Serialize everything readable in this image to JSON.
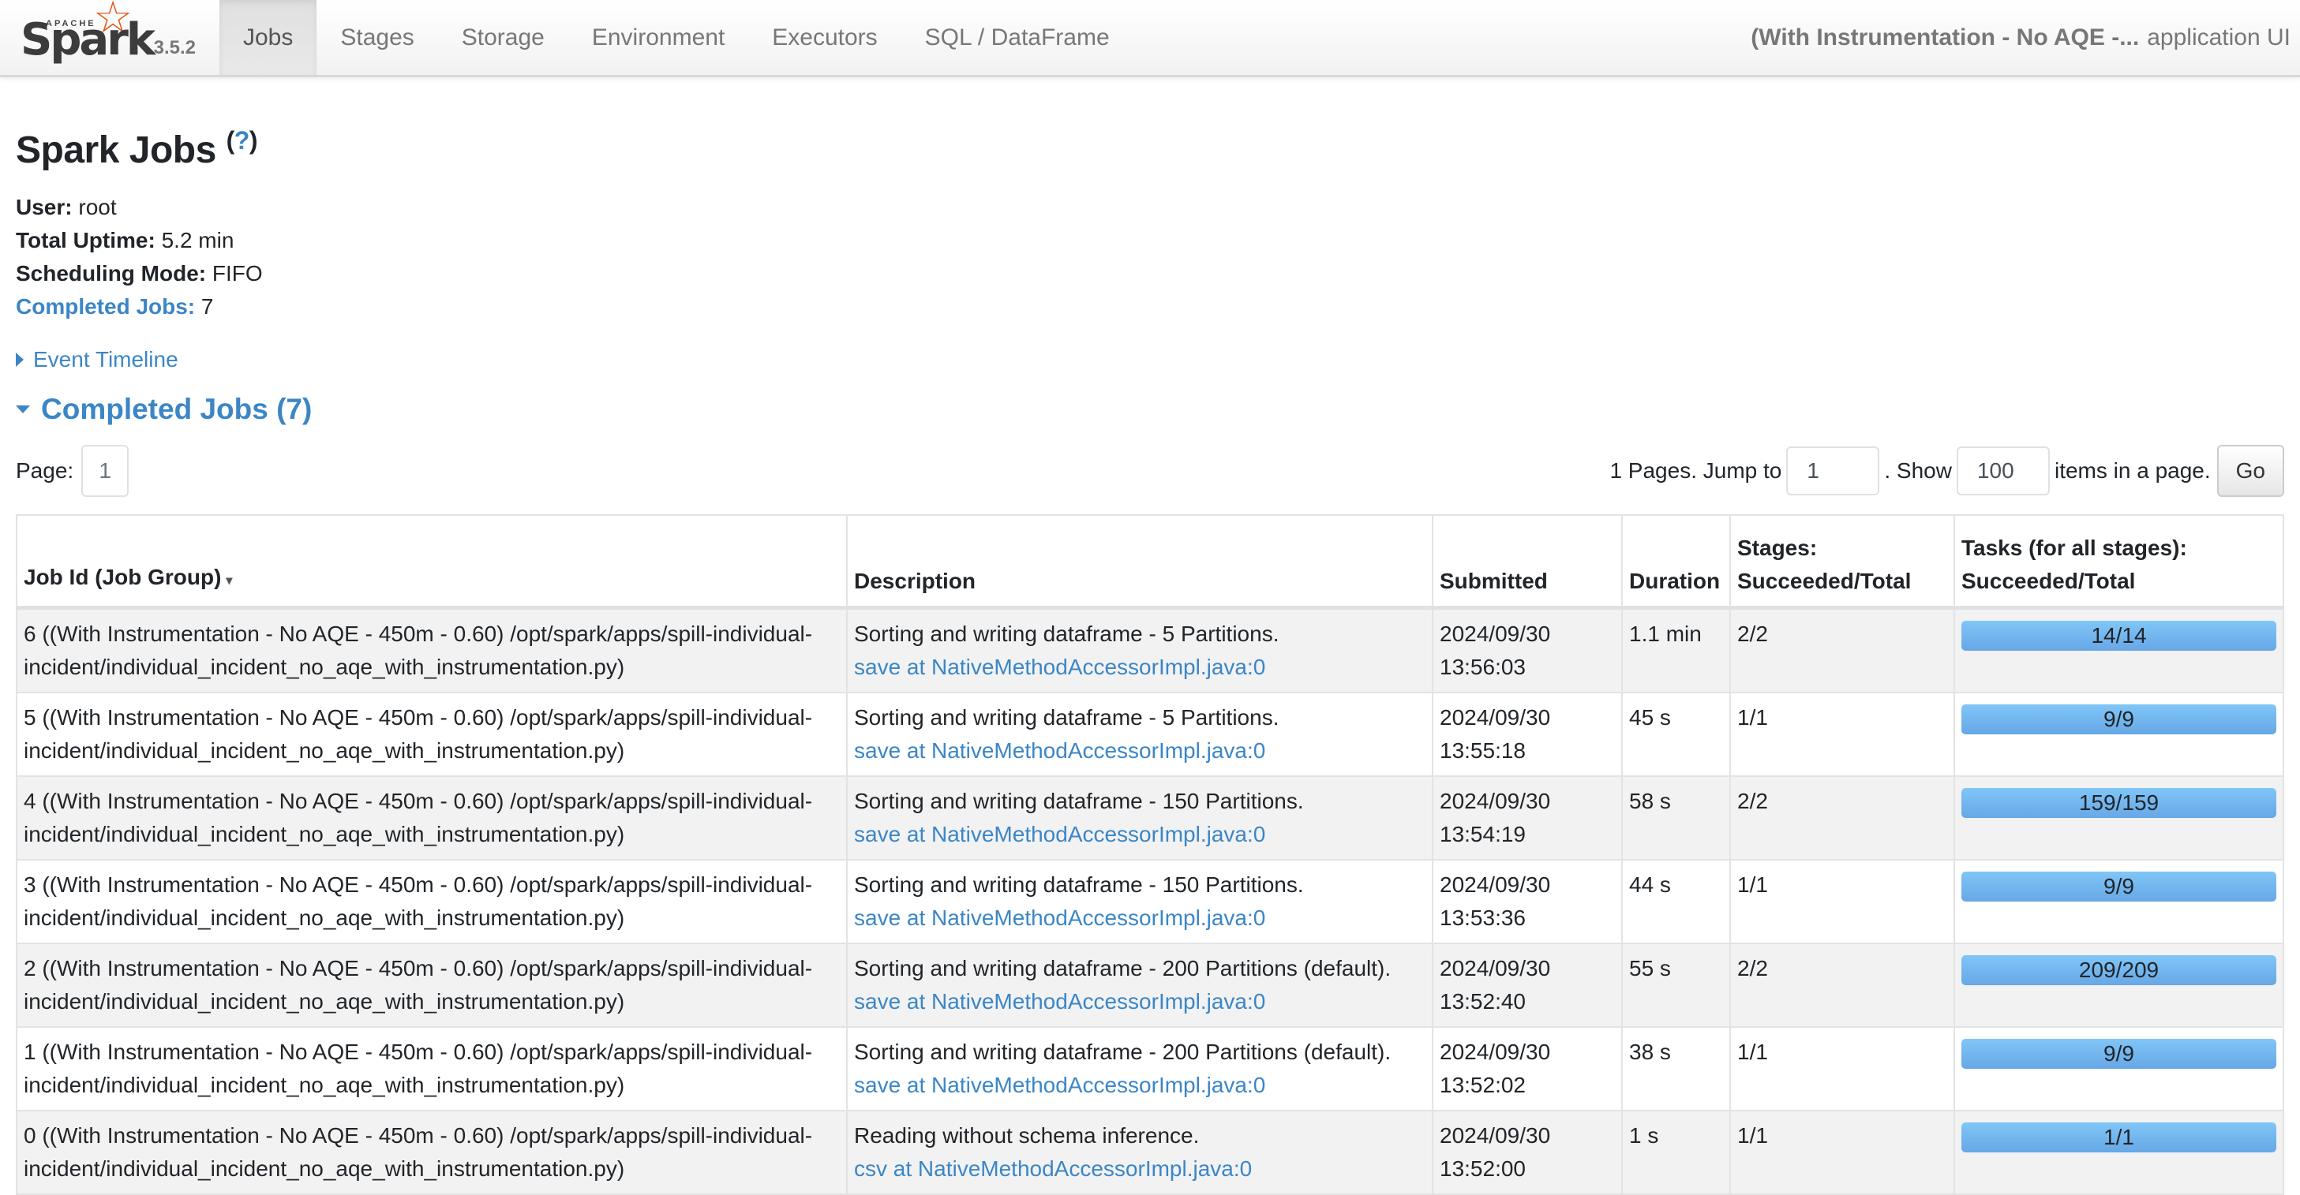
{
  "navbar": {
    "logo": {
      "apache": "APACHE",
      "spark": "Spark"
    },
    "version": "3.5.2",
    "tabs": [
      {
        "label": "Jobs",
        "active": true
      },
      {
        "label": "Stages"
      },
      {
        "label": "Storage"
      },
      {
        "label": "Environment"
      },
      {
        "label": "Executors"
      },
      {
        "label": "SQL / DataFrame"
      }
    ],
    "app_name": "(With Instrumentation - No AQE -...",
    "app_suffix": "application UI"
  },
  "page": {
    "title": "Spark Jobs",
    "help": "?",
    "summary": {
      "user_label": "User:",
      "user": "root",
      "uptime_label": "Total Uptime:",
      "uptime": "5.2 min",
      "mode_label": "Scheduling Mode:",
      "mode": "FIFO",
      "completed_label": "Completed Jobs:",
      "completed": "7"
    },
    "event_timeline": "Event Timeline",
    "completed_header": "Completed Jobs (7)"
  },
  "pager": {
    "page_label": "Page:",
    "current_page": "1",
    "pages_text": "1 Pages. Jump to",
    "jump_value": "1",
    "show_text": ". Show",
    "show_value": "100",
    "items_text": "items in a page.",
    "go_label": "Go"
  },
  "table": {
    "headers": {
      "job_id": "Job Id (Job Group)",
      "sort_indicator": "▾",
      "description": "Description",
      "submitted": "Submitted",
      "duration": "Duration",
      "stages_1": "Stages:",
      "stages_2": "Succeeded/Total",
      "tasks_1": "Tasks (for all stages):",
      "tasks_2": "Succeeded/Total"
    },
    "rows": [
      {
        "job": "6 ((With Instrumentation - No AQE - 450m - 0.60) /opt/spark/apps/spill-individual-incident/individual_incident_no_aqe_with_instrumentation.py)",
        "desc": "Sorting and writing dataframe - 5 Partitions.",
        "link": "save at NativeMethodAccessorImpl.java:0",
        "date": "2024/09/30",
        "time": "13:56:03",
        "duration": "1.1 min",
        "stages": "2/2",
        "tasks": "14/14",
        "tasks_fraction": 1.0
      },
      {
        "job": "5 ((With Instrumentation - No AQE - 450m - 0.60) /opt/spark/apps/spill-individual-incident/individual_incident_no_aqe_with_instrumentation.py)",
        "desc": "Sorting and writing dataframe - 5 Partitions.",
        "link": "save at NativeMethodAccessorImpl.java:0",
        "date": "2024/09/30",
        "time": "13:55:18",
        "duration": "45 s",
        "stages": "1/1",
        "tasks": "9/9",
        "tasks_fraction": 1.0
      },
      {
        "job": "4 ((With Instrumentation - No AQE - 450m - 0.60) /opt/spark/apps/spill-individual-incident/individual_incident_no_aqe_with_instrumentation.py)",
        "desc": "Sorting and writing dataframe - 150 Partitions.",
        "link": "save at NativeMethodAccessorImpl.java:0",
        "date": "2024/09/30",
        "time": "13:54:19",
        "duration": "58 s",
        "stages": "2/2",
        "tasks": "159/159",
        "tasks_fraction": 1.0
      },
      {
        "job": "3 ((With Instrumentation - No AQE - 450m - 0.60) /opt/spark/apps/spill-individual-incident/individual_incident_no_aqe_with_instrumentation.py)",
        "desc": "Sorting and writing dataframe - 150 Partitions.",
        "link": "save at NativeMethodAccessorImpl.java:0",
        "date": "2024/09/30",
        "time": "13:53:36",
        "duration": "44 s",
        "stages": "1/1",
        "tasks": "9/9",
        "tasks_fraction": 1.0
      },
      {
        "job": "2 ((With Instrumentation - No AQE - 450m - 0.60) /opt/spark/apps/spill-individual-incident/individual_incident_no_aqe_with_instrumentation.py)",
        "desc": "Sorting and writing dataframe - 200 Partitions (default).",
        "link": "save at NativeMethodAccessorImpl.java:0",
        "date": "2024/09/30",
        "time": "13:52:40",
        "duration": "55 s",
        "stages": "2/2",
        "tasks": "209/209",
        "tasks_fraction": 1.0
      },
      {
        "job": "1 ((With Instrumentation - No AQE - 450m - 0.60) /opt/spark/apps/spill-individual-incident/individual_incident_no_aqe_with_instrumentation.py)",
        "desc": "Sorting and writing dataframe - 200 Partitions (default).",
        "link": "save at NativeMethodAccessorImpl.java:0",
        "date": "2024/09/30",
        "time": "13:52:02",
        "duration": "38 s",
        "stages": "1/1",
        "tasks": "9/9",
        "tasks_fraction": 1.0
      },
      {
        "job": "0 ((With Instrumentation - No AQE - 450m - 0.60) /opt/spark/apps/spill-individual-incident/individual_incident_no_aqe_with_instrumentation.py)",
        "desc": "Reading without schema inference.",
        "link": "csv at NativeMethodAccessorImpl.java:0",
        "date": "2024/09/30",
        "time": "13:52:00",
        "duration": "1 s",
        "stages": "1/1",
        "tasks": "1/1",
        "tasks_fraction": 1.0
      }
    ]
  },
  "colors": {
    "link": "#3b86c6",
    "logo_star": "#e25a1c",
    "progress": "#6fb2ec"
  }
}
